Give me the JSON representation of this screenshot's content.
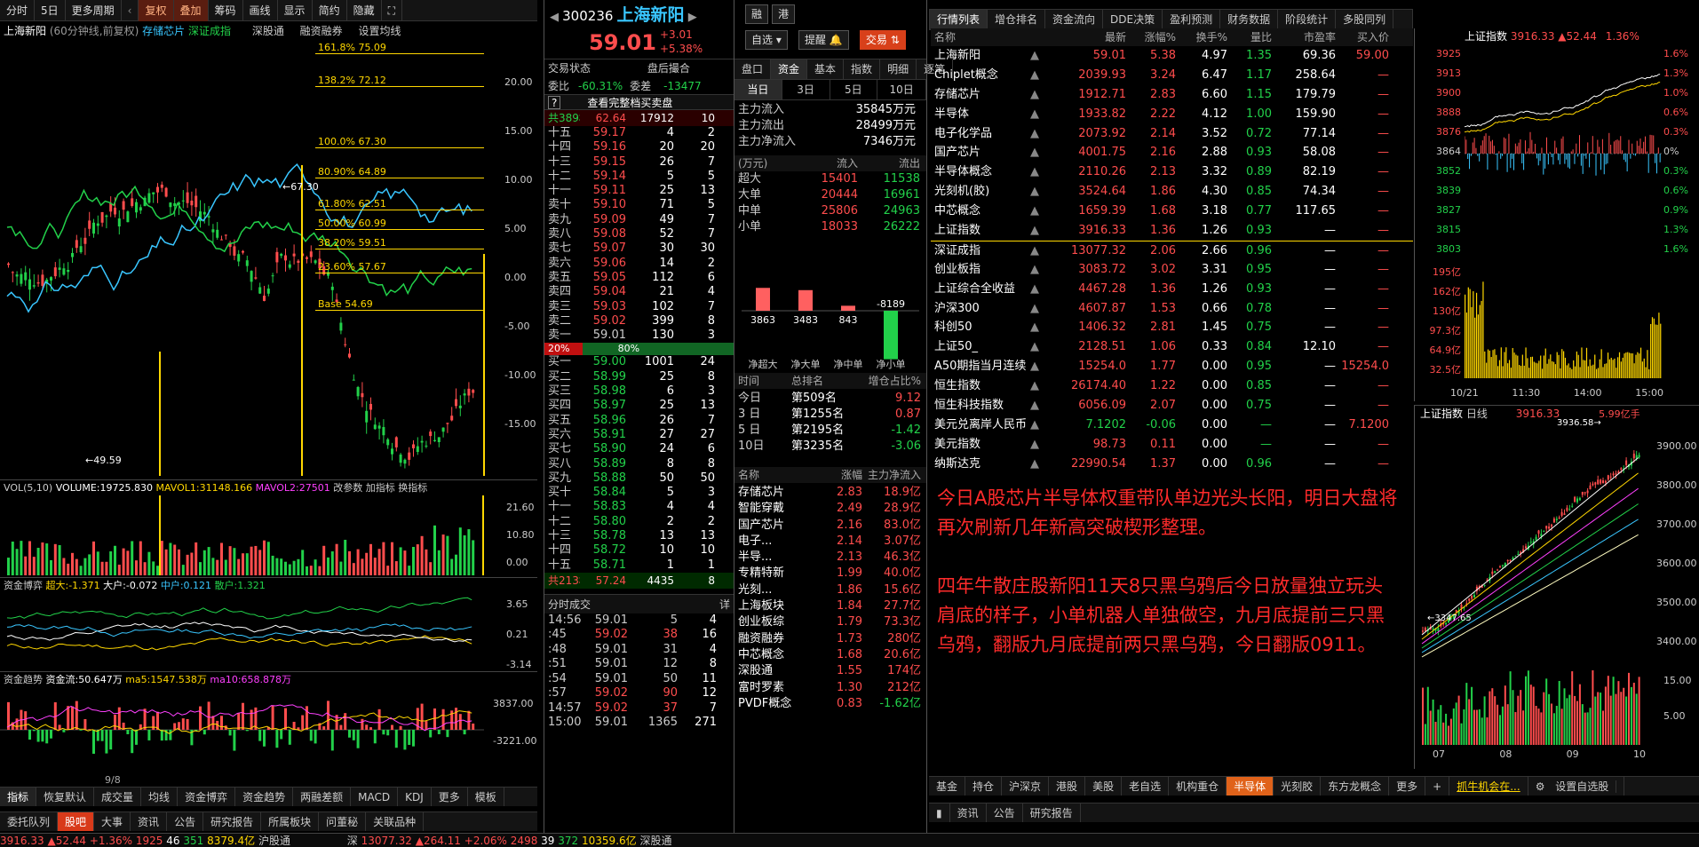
{
  "left_toolbar": [
    "分时",
    "5日",
    "更多周期",
    "复权",
    "叠加",
    "筹码",
    "画线",
    "显示",
    "简约",
    "隐藏"
  ],
  "chart_info": {
    "title": "上海新阳",
    "period": "(60分钟线,前复权)",
    "overlay1": "存储芯片",
    "overlay2": "深证成指",
    "links": [
      "深股通",
      "融资融券",
      "设置均线"
    ]
  },
  "fib_levels": [
    {
      "label": "161.8% 75.09"
    },
    {
      "label": "138.2% 72.12"
    },
    {
      "label": "100.0% 67.30"
    },
    {
      "label": "80.90% 64.89"
    },
    {
      "label": "61.80% 62.51"
    },
    {
      "label": "50.00% 60.99"
    },
    {
      "label": "38.20% 59.51"
    },
    {
      "label": "23.60% 57.67"
    },
    {
      "label": "Base  54.69"
    }
  ],
  "price_scale": [
    "20.00",
    "15.00",
    "10.00",
    "5.00",
    "0.00",
    "-5.00",
    "-10.00",
    "-15.00"
  ],
  "price_marks": [
    "67.30",
    "49.59"
  ],
  "vol": {
    "label": "VOL(5,10)",
    "volume": "VOLUME:19725.830",
    "mavol1": "MAVOL1:31148.166",
    "mavol2": "MAVOL2:27501",
    "links": [
      "改参数",
      "加指标",
      "换指标"
    ],
    "scale": [
      "21.60",
      "10.80",
      "0.00"
    ]
  },
  "boyi": {
    "label": "资金博弈",
    "super": "超大:-1.371",
    "big": "大户:-0.072",
    "mid": "中户:0.121",
    "small": "散户:1.321",
    "scale": [
      "3.65",
      "0.21",
      "-3.14"
    ]
  },
  "trend": {
    "label": "资金趋势",
    "flow": "资金流:50.647万",
    "ma5": "ma5:1547.538万",
    "ma10": "ma10:658.878万",
    "scale": [
      "3837.00",
      "-3221.00"
    ]
  },
  "date_label": "9/8",
  "bottom_tabs1": [
    "指标",
    "恢复默认",
    "成交量",
    "均线",
    "资金博弈",
    "资金趋势",
    "两融差额",
    "MACD",
    "KDJ",
    "更多",
    "模板"
  ],
  "bottom_tabs2": [
    "委托队列",
    "股吧",
    "大事",
    "资讯",
    "公告",
    "研究报告",
    "所属板块",
    "问董秘",
    "关联品种"
  ],
  "quote": {
    "code": "300236",
    "name": "上海新阳",
    "price": "59.01",
    "change": "+3.01",
    "pct": "+5.38%",
    "btn_watch": "自选",
    "btn_alert": "提醒",
    "btn_trade": "交易",
    "status_label": "交易状态",
    "status": "盘后撮合",
    "weibi": "委比",
    "weibi_val": "-60.31%",
    "weicha": "委差",
    "weicha_val": "-13477",
    "full_book": "查看完整档买卖盘",
    "ask_total": "共389档",
    "ask_avg": "62.64",
    "ask_vol": "17912",
    "ask_cnt": "10",
    "bid_total": "共213档",
    "bid_avg": "57.24",
    "bid_vol": "4435",
    "bid_cnt": "8",
    "ratio_left": "20%",
    "ratio_right": "80%"
  },
  "asks": [
    [
      "十五",
      "59.17",
      "4",
      "2"
    ],
    [
      "十四",
      "59.16",
      "20",
      "20"
    ],
    [
      "十三",
      "59.15",
      "26",
      "7"
    ],
    [
      "十二",
      "59.14",
      "5",
      "5"
    ],
    [
      "十一",
      "59.11",
      "25",
      "13"
    ],
    [
      "卖十",
      "59.10",
      "71",
      "5"
    ],
    [
      "卖九",
      "59.09",
      "49",
      "7"
    ],
    [
      "卖八",
      "59.08",
      "52",
      "7"
    ],
    [
      "卖七",
      "59.07",
      "30",
      "30"
    ],
    [
      "卖六",
      "59.06",
      "14",
      "2"
    ],
    [
      "卖五",
      "59.05",
      "112",
      "6"
    ],
    [
      "卖四",
      "59.04",
      "21",
      "4"
    ],
    [
      "卖三",
      "59.03",
      "102",
      "7"
    ],
    [
      "卖二",
      "59.02",
      "399",
      "8"
    ],
    [
      "卖一",
      "59.01",
      "130",
      "3"
    ]
  ],
  "bids": [
    [
      "买一",
      "59.00",
      "1001",
      "24"
    ],
    [
      "买二",
      "58.99",
      "25",
      "8"
    ],
    [
      "买三",
      "58.98",
      "6",
      "3"
    ],
    [
      "买四",
      "58.97",
      "25",
      "13"
    ],
    [
      "买五",
      "58.96",
      "26",
      "7"
    ],
    [
      "买六",
      "58.91",
      "27",
      "27"
    ],
    [
      "买七",
      "58.90",
      "24",
      "6"
    ],
    [
      "买八",
      "58.89",
      "8",
      "8"
    ],
    [
      "买九",
      "58.88",
      "50",
      "50"
    ],
    [
      "买十",
      "58.84",
      "5",
      "3"
    ],
    [
      "十一",
      "58.83",
      "4",
      "4"
    ],
    [
      "十二",
      "58.80",
      "2",
      "2"
    ],
    [
      "十三",
      "58.78",
      "13",
      "13"
    ],
    [
      "十四",
      "58.72",
      "10",
      "10"
    ],
    [
      "十五",
      "58.71",
      "1",
      "1"
    ]
  ],
  "ticks_title": "分时成交",
  "ticks_more": "详",
  "ticks": [
    [
      "14:56",
      "59.01",
      "5",
      "4"
    ],
    [
      ":45",
      "59.02",
      "38",
      "16"
    ],
    [
      ":48",
      "59.01",
      "31",
      "4"
    ],
    [
      ":51",
      "59.01",
      "12",
      "8"
    ],
    [
      ":54",
      "59.01",
      "50",
      "11"
    ],
    [
      ":57",
      "59.02",
      "90",
      "12"
    ],
    [
      "14:57",
      "59.02",
      "37",
      "7"
    ],
    [
      "15:00",
      "59.01",
      "1365",
      "271"
    ]
  ],
  "mid_tabs": [
    "盘口",
    "资金",
    "基本",
    "指数",
    "明细",
    "逐笔"
  ],
  "period_tabs": [
    "当日",
    "3日",
    "5日",
    "10日"
  ],
  "funds": [
    [
      "主力流入",
      "35845万元"
    ],
    [
      "主力流出",
      "28499万元"
    ],
    [
      "主力净流入",
      "7346万元"
    ]
  ],
  "flow_hdr": [
    "(万元)",
    "流入",
    "流出"
  ],
  "flow_rows": [
    [
      "超大",
      "15401",
      "11538"
    ],
    [
      "大单",
      "20444",
      "16961"
    ],
    [
      "中单",
      "25806",
      "24963"
    ],
    [
      "小单",
      "18033",
      "26222"
    ]
  ],
  "net_bars": {
    "values": [
      3863,
      3483,
      843,
      -8189
    ],
    "labels": [
      "3863",
      "3483",
      "843",
      "-8189"
    ],
    "cats": [
      "净超大",
      "净大单",
      "净中单",
      "净小单"
    ]
  },
  "rank_hdr": [
    "时间",
    "总排名",
    "增仓占比%"
  ],
  "ranks": [
    [
      "今日",
      "第509名",
      "9.12"
    ],
    [
      "3 日",
      "第1255名",
      "0.87"
    ],
    [
      "5 日",
      "第2195名",
      "-1.42"
    ],
    [
      "10日",
      "第3235名",
      "-3.06"
    ]
  ],
  "sector_hdr": [
    "名称",
    "涨幅",
    "主力净流入"
  ],
  "sectors": [
    [
      "存储芯片",
      "2.83",
      "18.9亿"
    ],
    [
      "智能穿戴",
      "2.49",
      "28.9亿"
    ],
    [
      "国产芯片",
      "2.16",
      "83.0亿"
    ],
    [
      "电子...",
      "2.14",
      "3.07亿"
    ],
    [
      "半导...",
      "2.13",
      "46.3亿"
    ],
    [
      "专精特新",
      "1.99",
      "40.0亿"
    ],
    [
      "光刻...",
      "1.86",
      "15.6亿"
    ],
    [
      "上海板块",
      "1.84",
      "27.7亿"
    ],
    [
      "创业板综",
      "1.79",
      "73.3亿"
    ],
    [
      "融资融券",
      "1.73",
      "280亿"
    ],
    [
      "中芯概念",
      "1.68",
      "20.6亿"
    ],
    [
      "深股通",
      "1.55",
      "174亿"
    ],
    [
      "富时罗素",
      "1.30",
      "212亿"
    ],
    [
      "PVDF概念",
      "0.83",
      "-1.62亿"
    ]
  ],
  "right_tabs": [
    "行情列表",
    "增仓排名",
    "资金流向",
    "DDE决策",
    "盈利预测",
    "财务数据",
    "阶段统计",
    "多股同列"
  ],
  "list_hdr": [
    "名称",
    "最新",
    "涨幅%",
    "换手%",
    "量比",
    "市盈率",
    "买入价"
  ],
  "list": [
    [
      "上海新阳",
      "59.01",
      "5.38",
      "4.97",
      "1.35",
      "69.36",
      "59.00"
    ],
    [
      "Chiplet概念",
      "2039.93",
      "3.24",
      "6.47",
      "1.17",
      "258.64",
      "—"
    ],
    [
      "存储芯片",
      "1912.71",
      "2.83",
      "6.60",
      "1.15",
      "179.79",
      "—"
    ],
    [
      "半导体",
      "1933.82",
      "2.22",
      "4.12",
      "1.00",
      "159.90",
      "—"
    ],
    [
      "电子化学品",
      "2073.92",
      "2.14",
      "3.52",
      "0.72",
      "77.14",
      "—"
    ],
    [
      "国产芯片",
      "4001.75",
      "2.16",
      "2.88",
      "0.93",
      "58.08",
      "—"
    ],
    [
      "半导体概念",
      "2110.26",
      "2.13",
      "3.32",
      "0.89",
      "82.19",
      "—"
    ],
    [
      "光刻机(胶)",
      "3524.64",
      "1.86",
      "4.30",
      "0.85",
      "74.34",
      "—"
    ],
    [
      "中芯概念",
      "1659.39",
      "1.68",
      "3.18",
      "0.77",
      "117.65",
      "—"
    ],
    [
      "上证指数",
      "3916.33",
      "1.36",
      "1.26",
      "0.93",
      "—",
      "—"
    ],
    [
      "深证成指",
      "13077.32",
      "2.06",
      "2.66",
      "0.96",
      "—",
      "—"
    ],
    [
      "创业板指",
      "3083.72",
      "3.02",
      "3.31",
      "0.95",
      "—",
      "—"
    ],
    [
      "上证综合全收益",
      "4467.28",
      "1.36",
      "1.26",
      "0.93",
      "—",
      "—"
    ],
    [
      "沪深300",
      "4607.87",
      "1.53",
      "0.66",
      "0.78",
      "—",
      "—"
    ],
    [
      "科创50",
      "1406.32",
      "2.81",
      "1.45",
      "0.75",
      "—",
      "—"
    ],
    [
      "上证50_",
      "2128.51",
      "1.06",
      "0.33",
      "0.84",
      "12.10",
      "—"
    ],
    [
      "A50期指当月连续",
      "15254.0",
      "1.77",
      "0.00",
      "0.95",
      "—",
      "15254.0"
    ],
    [
      "恒生指数",
      "26174.40",
      "1.22",
      "0.00",
      "0.85",
      "—",
      "—"
    ],
    [
      "恒生科技指数",
      "6056.09",
      "2.07",
      "0.00",
      "0.75",
      "—",
      "—"
    ],
    [
      "美元兑离岸人民币",
      "7.1202",
      "-0.06",
      "0.00",
      "—",
      "—",
      "7.1200"
    ],
    [
      "美元指数",
      "98.73",
      "0.11",
      "0.00",
      "—",
      "—",
      "—"
    ],
    [
      "纳斯达克",
      "22990.54",
      "1.37",
      "0.00",
      "0.96",
      "—",
      "—"
    ]
  ],
  "note1": "今日A股芯片半导体权重带队单边光头长阳，明日大盘将再次刷新几年新高突破楔形整理。",
  "note2": "四年牛散庄股新阳11天8只黑乌鸦后今日放量独立玩头肩底的样子，小单机器人单独做空，九月底提前三只黑乌鸦，翻版九月底提前两只黑乌鸦，今日翻版0911。",
  "index_mini": {
    "name": "上证指数",
    "price": "3916.33",
    "chg": "52.44",
    "pct": "1.36%",
    "left": [
      "3925",
      "3913",
      "3900",
      "3888",
      "3876",
      "3864",
      "3852",
      "3839",
      "3827",
      "3815",
      "3803"
    ],
    "right": [
      "1.6%",
      "1.3%",
      "1.0%",
      "0.6%",
      "0.3%",
      "0%",
      "0.3%",
      "0.6%",
      "0.9%",
      "1.3%",
      "1.6%"
    ],
    "vol": [
      "195亿",
      "162亿",
      "130亿",
      "97.3亿",
      "64.9亿",
      "32.5亿"
    ],
    "times": [
      "10/21",
      "11:30",
      "14:00",
      "15:00"
    ]
  },
  "index_day": {
    "name": "上证指数",
    "period": "日线",
    "price": "3916.33",
    "amount": "5.99亿手",
    "high": "3936.58",
    "low": "3347.65",
    "scale": [
      "3900.00",
      "3800.00",
      "3700.00",
      "3600.00",
      "3500.00",
      "3400.00"
    ],
    "vol_scale": [
      "15.00",
      "5.00"
    ],
    "months": [
      "07",
      "08",
      "09",
      "10"
    ]
  },
  "bottom_tabs3": [
    "基金",
    "持仓",
    "沪深京",
    "港股",
    "美股",
    "老自选",
    "机构重仓",
    "半导体",
    "光刻胶",
    "东方龙概念",
    "更多",
    "抓牛机会在...",
    "设置自选股"
  ],
  "bottom_tabs4": [
    "资讯",
    "公告",
    "研究报告"
  ],
  "status": {
    "sh": "3916.33",
    "sh_chg": "52.44",
    "sh_pct": "+1.36%",
    "sh_up": "1925",
    "sh_flat": "46",
    "sh_down": "351",
    "sh_amt": "8379.4亿",
    "hgt": "沪股通",
    "sz_label": "深",
    "sz": "13077.32",
    "sz_chg": "264.11",
    "sz_pct": "+2.06%",
    "sz_up": "2498",
    "sz_flat": "39",
    "sz_down": "372",
    "sz_amt": "10359.6亿",
    "sgt": "深股通"
  },
  "colors": {
    "up": "#ff4d4d",
    "down": "#22d14a",
    "fib": "#ffd700",
    "accent": "#ff7a00"
  }
}
